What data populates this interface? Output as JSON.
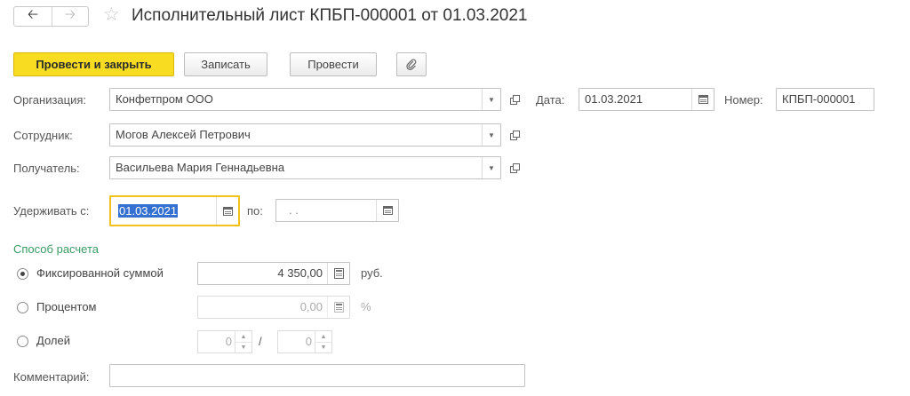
{
  "header": {
    "back_icon": "arrow-left-icon",
    "forward_icon": "arrow-right-icon",
    "favorite_icon": "star-icon",
    "title": "Исполнительный лист КПБП-000001 от 01.03.2021"
  },
  "toolbar": {
    "post_and_close": "Провести и закрыть",
    "save": "Записать",
    "post": "Провести",
    "attach_icon": "paperclip-icon"
  },
  "form": {
    "organization": {
      "label": "Организация:",
      "value": "Конфетпром ООО"
    },
    "date": {
      "label": "Дата:",
      "value": "01.03.2021"
    },
    "number": {
      "label": "Номер:",
      "value": "КПБП-000001"
    },
    "employee": {
      "label": "Сотрудник:",
      "value": "Могов Алексей Петрович"
    },
    "recipient": {
      "label": "Получатель:",
      "value": "Васильева Мария Геннадьевна"
    },
    "withhold_from": {
      "label": "Удерживать с:",
      "value": "01.03.2021"
    },
    "withhold_to": {
      "label": "по:",
      "value": " .  ."
    },
    "calc_method": {
      "title": "Способ расчета",
      "fixed": {
        "label": "Фиксированной суммой",
        "value": "4 350,00",
        "unit": "руб.",
        "selected": true
      },
      "percent": {
        "label": "Процентом",
        "value": "0,00",
        "unit": "%",
        "selected": false
      },
      "share": {
        "label": "Долей",
        "numerator": "0",
        "separator": "/",
        "denominator": "0",
        "selected": false
      }
    },
    "comment": {
      "label": "Комментарий:",
      "value": ""
    }
  },
  "colors": {
    "primary_button": "#f7dc22",
    "section_title": "#3a9b63",
    "focus_border": "#f2c21b",
    "selection": "#3470d0"
  }
}
